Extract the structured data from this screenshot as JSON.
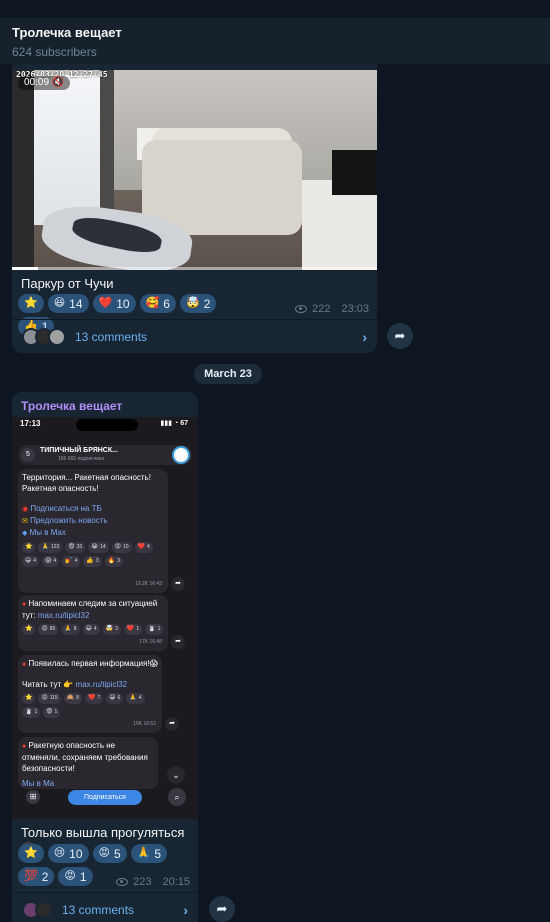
{
  "header": {
    "title": "Тролечка вещает",
    "subscribers": "624 subscribers"
  },
  "post1": {
    "video_timestamp": "2026/03/20 12:27:45",
    "video_time": "00:09",
    "video_progress": 0.07,
    "caption": "Паркур от Чучи",
    "reactions": [
      {
        "emoji": "⭐",
        "count": ""
      },
      {
        "emoji": "😆",
        "count": "14"
      },
      {
        "emoji": "❤️",
        "count": "10"
      },
      {
        "emoji": "🥰",
        "count": "6"
      },
      {
        "emoji": "🤯",
        "count": "2"
      },
      {
        "emoji": "👍",
        "count": "1"
      }
    ],
    "views": "222",
    "time": "23:03",
    "comments": "13 comments"
  },
  "date_separator": "March 23",
  "post2": {
    "author": "Тролечка вещает",
    "caption": "Только вышла прогуляться",
    "reactions": [
      {
        "emoji": "⭐",
        "count": ""
      },
      {
        "emoji": "😢",
        "count": "10"
      },
      {
        "emoji": "😡",
        "count": "5"
      },
      {
        "emoji": "🙏",
        "count": "5"
      },
      {
        "emoji": "💯",
        "count": "2"
      },
      {
        "emoji": "😡",
        "count": "1"
      }
    ],
    "views": "223",
    "time": "20:15",
    "comments": "13 comments",
    "screenshot": {
      "status_time": "17:13",
      "status_right": "67",
      "back_count": "5",
      "channel_name": "ТИПИЧНЫЙ БРЯНСК...",
      "channel_subs": "166 665 подписчика",
      "msg1_text": "Территория... Ракетная опасность! Ракетная опасность!",
      "msg1_link1": "Подписаться на ТБ",
      "msg1_link2": "Предложить новость",
      "msg1_link3": "Мы в Max",
      "msg1_reacts": [
        {
          "e": "⭐",
          "c": ""
        },
        {
          "e": "🙏",
          "c": "123"
        },
        {
          "e": "😨",
          "c": "33"
        },
        {
          "e": "😭",
          "c": "14"
        },
        {
          "e": "😡",
          "c": "10"
        },
        {
          "e": "❤️",
          "c": "4"
        },
        {
          "e": "😁",
          "c": "4"
        },
        {
          "e": "😱",
          "c": "4"
        },
        {
          "e": "💅",
          "c": "4"
        },
        {
          "e": "👍",
          "c": "3"
        },
        {
          "e": "🔥",
          "c": "3"
        }
      ],
      "msg1_meta": "19,2K 16:43",
      "msg2_text": "Напоминаем следим за ситуацией тут:",
      "msg2_link": "max.ru/tipicl32",
      "msg2_reacts": [
        {
          "e": "⭐",
          "c": ""
        },
        {
          "e": "😡",
          "c": "85"
        },
        {
          "e": "🙏",
          "c": "8"
        },
        {
          "e": "😁",
          "c": "4"
        },
        {
          "e": "🤯",
          "c": "3"
        },
        {
          "e": "❤️",
          "c": "1"
        },
        {
          "e": "☃️",
          "c": "1"
        }
      ],
      "msg2_meta": "17K 16:48",
      "msg3_text": "Появилась первая информация!😱",
      "msg3_read": "Читать тут 👉",
      "msg3_link": "max.ru/tipicl32",
      "msg3_reacts": [
        {
          "e": "⭐",
          "c": ""
        },
        {
          "e": "😡",
          "c": "115"
        },
        {
          "e": "🙉",
          "c": "8"
        },
        {
          "e": "❤️",
          "c": "7"
        },
        {
          "e": "😁",
          "c": "6"
        },
        {
          "e": "🙏",
          "c": "4"
        },
        {
          "e": "☃️",
          "c": "1"
        },
        {
          "e": "😨",
          "c": "1"
        }
      ],
      "msg3_meta": "16K 16:52",
      "msg4_text": "Ракетную опасность не отменяли, сохраняем требования безопасности!",
      "msg4_tail": "Мы в Ma",
      "subscribe_label": "Подписаться"
    }
  },
  "colors": {
    "background": "#0e1621",
    "bubble": "#182533",
    "reaction": "#2b5278",
    "link": "#6ab2f2",
    "author": "#b48ef7"
  }
}
